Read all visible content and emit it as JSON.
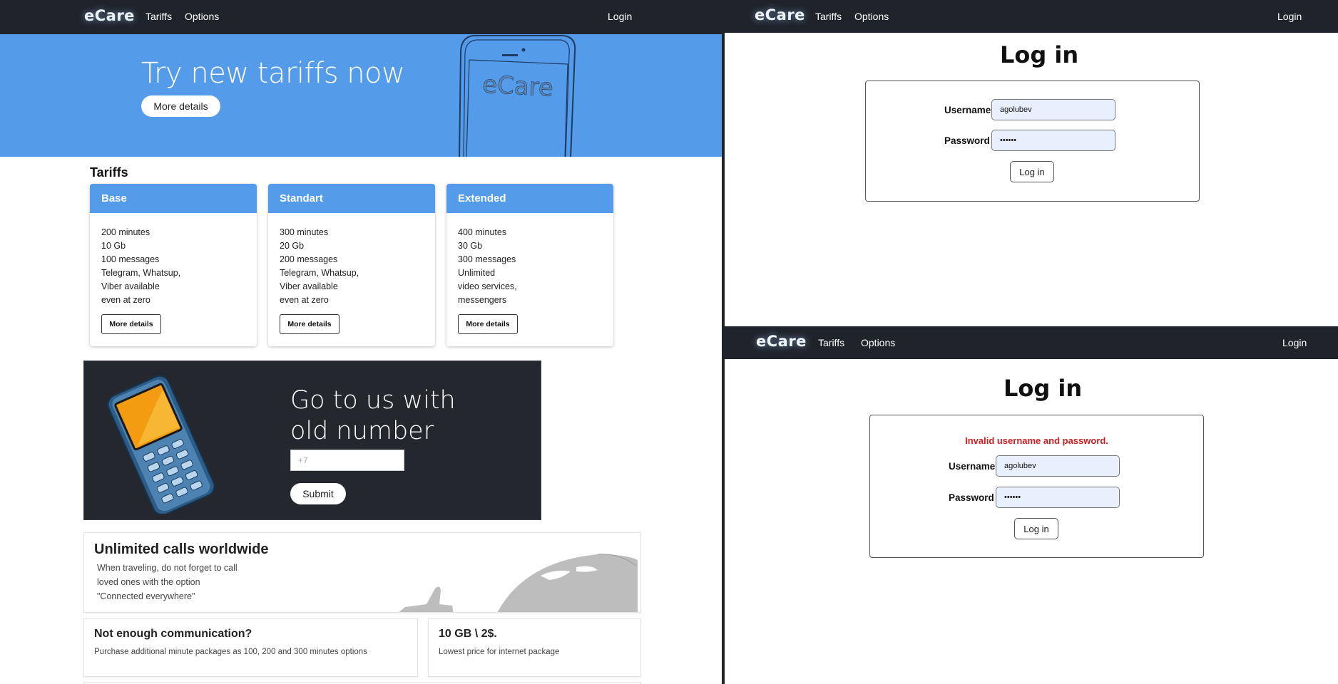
{
  "nav": {
    "logo": "eCare",
    "tariffs": "Tariffs",
    "options": "Options",
    "login": "Login"
  },
  "hero": {
    "title": "Try new tariffs now",
    "button": "More details",
    "phone_label": "eCare",
    "bg_color": "#549be9"
  },
  "tariffs": {
    "title": "Tariffs",
    "cards": [
      {
        "name": "Base",
        "lines": [
          "200 minutes",
          "10 Gb",
          "100 messages",
          "Telegram, Whatsup,",
          "Viber available",
          "even at zero"
        ],
        "button": "More details"
      },
      {
        "name": "Standart",
        "lines": [
          "300 minutes",
          "20 Gb",
          "200 messages",
          "Telegram, Whatsup,",
          "Viber available",
          "even at zero"
        ],
        "button": "More details"
      },
      {
        "name": "Extended",
        "lines": [
          "400 minutes",
          "30 Gb",
          "300 messages",
          "Unlimited",
          "video services,",
          "messengers"
        ],
        "button": "More details"
      }
    ]
  },
  "promo": {
    "title_line1": "Go to us with",
    "title_line2": "old number",
    "input_placeholder": "+7",
    "button": "Submit"
  },
  "cards": {
    "calls": {
      "title": "Unlimited calls worldwide",
      "lines": [
        "When traveling, do not forget to call",
        "loved ones with the option",
        "\"Connected everywhere\""
      ]
    },
    "communication": {
      "title": "Not enough communication?",
      "text": "Purchase additional minute packages as 100, 200 and 300 minutes options"
    },
    "internet": {
      "title": "10 GB \\ 2$.",
      "text": "Lowest price for internet package"
    }
  },
  "login_top": {
    "title": "Log in",
    "username_label": "Username",
    "username_value": "agolubev",
    "password_label": "Password",
    "password_value": "••••••",
    "button": "Log in"
  },
  "login_bottom": {
    "title": "Log in",
    "error": "Invalid username and password.",
    "username_label": "Username",
    "username_value": "agolubev",
    "password_label": "Password",
    "password_value": "••••••",
    "button": "Log in"
  },
  "colors": {
    "nav_bg": "#1f232a",
    "accent": "#549be9",
    "error": "#cc1f1f"
  }
}
